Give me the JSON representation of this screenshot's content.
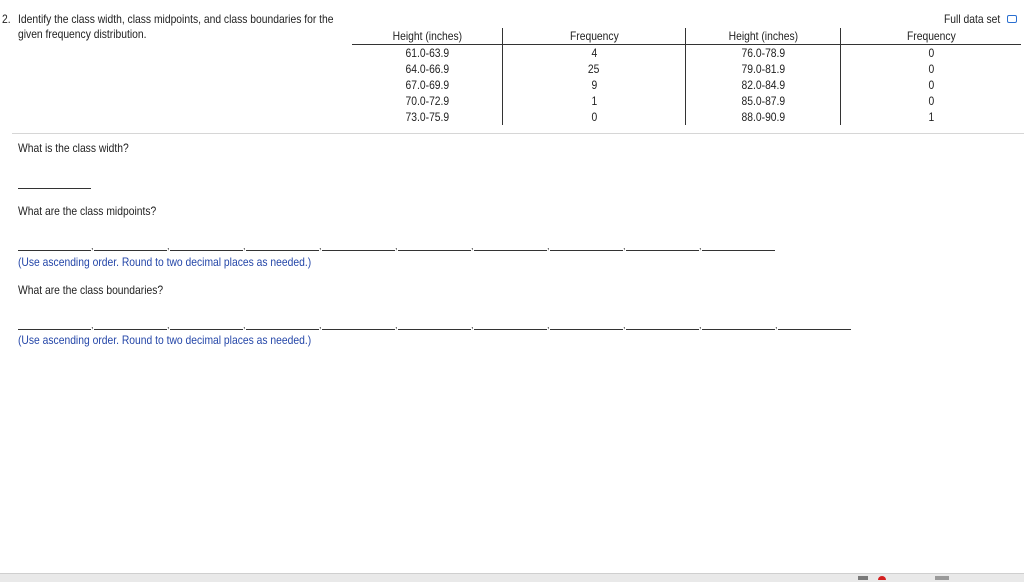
{
  "question": {
    "number": "2.",
    "prompt_line1": "Identify the class width, class midpoints, and class boundaries for the",
    "prompt_line2": "given frequency distribution."
  },
  "full_data_set_label": "Full data set",
  "table": {
    "headers": [
      "Height (inches)",
      "Frequency",
      "Height (inches)",
      "Frequency"
    ],
    "rows": [
      [
        "61.0-63.9",
        "4",
        "76.0-78.9",
        "0"
      ],
      [
        "64.0-66.9",
        "25",
        "79.0-81.9",
        "0"
      ],
      [
        "67.0-69.9",
        "9",
        "82.0-84.9",
        "0"
      ],
      [
        "70.0-72.9",
        "1",
        "85.0-87.9",
        "0"
      ],
      [
        "73.0-75.9",
        "0",
        "88.0-90.9",
        "1"
      ]
    ]
  },
  "parts": {
    "width_question": "What is the class width?",
    "midpoints_question": "What are the class midpoints?",
    "midpoints_hint": "(Use ascending order. Round to two decimal places as needed.)",
    "boundaries_question": "What are the class boundaries?",
    "boundaries_hint": "(Use ascending order. Round to two decimal places as needed.)"
  },
  "separator": ","
}
